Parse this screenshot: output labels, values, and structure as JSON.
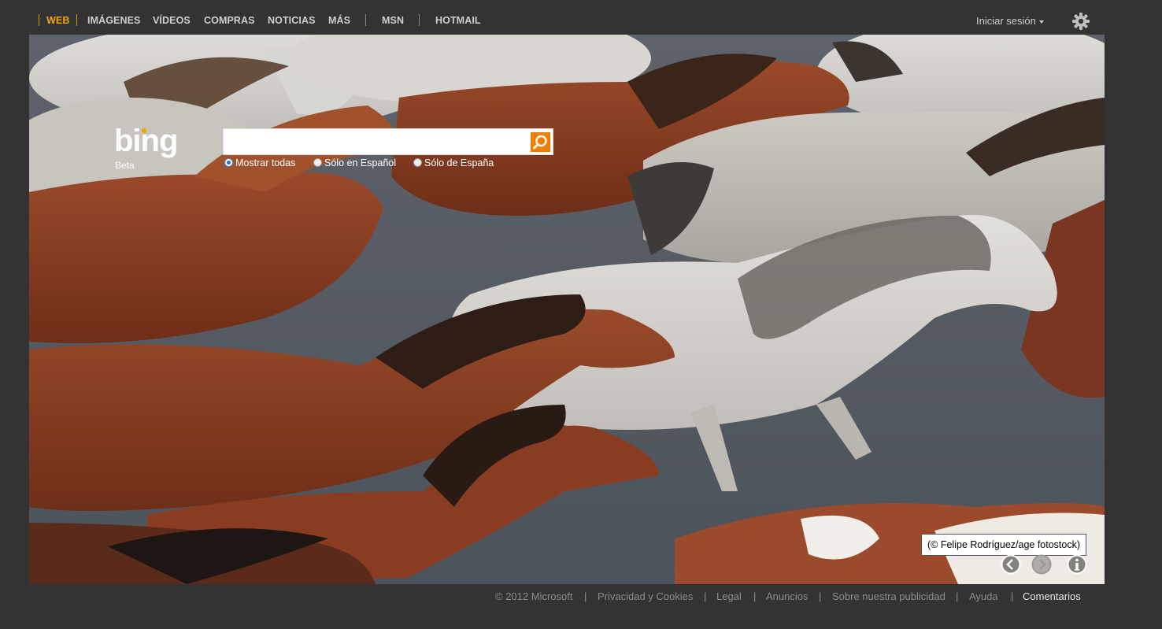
{
  "nav": {
    "items": [
      "WEB",
      "IMÁGENES",
      "VÍDEOS",
      "COMPRAS",
      "NOTICIAS",
      "MÁS",
      "MSN",
      "HOTMAIL"
    ],
    "signin": "Iniciar sesión"
  },
  "brand": {
    "logo": "bing",
    "tag": "Beta"
  },
  "search": {
    "value": "",
    "placeholder": "",
    "scopes": [
      "Mostrar todas",
      "Sólo en Español",
      "Sólo de España"
    ],
    "selected_scope": 0
  },
  "hero": {
    "credit": "(© Felipe Rodríguez/age fotostock)",
    "controls": [
      "previous-icon",
      "next-icon",
      "info-icon"
    ]
  },
  "footer": {
    "copyright": "© 2012 Microsoft",
    "links": [
      "Privacidad y Cookies",
      "Legal",
      "Anuncios",
      "Sobre nuestra publicidad",
      "Ayuda",
      "Comentarios"
    ]
  },
  "colors": {
    "background": "#333333",
    "accent": "#f0a30a",
    "search_button": "#f07d00",
    "nav_text": "#cfcfcf",
    "footer_text": "#8c8c8c"
  }
}
